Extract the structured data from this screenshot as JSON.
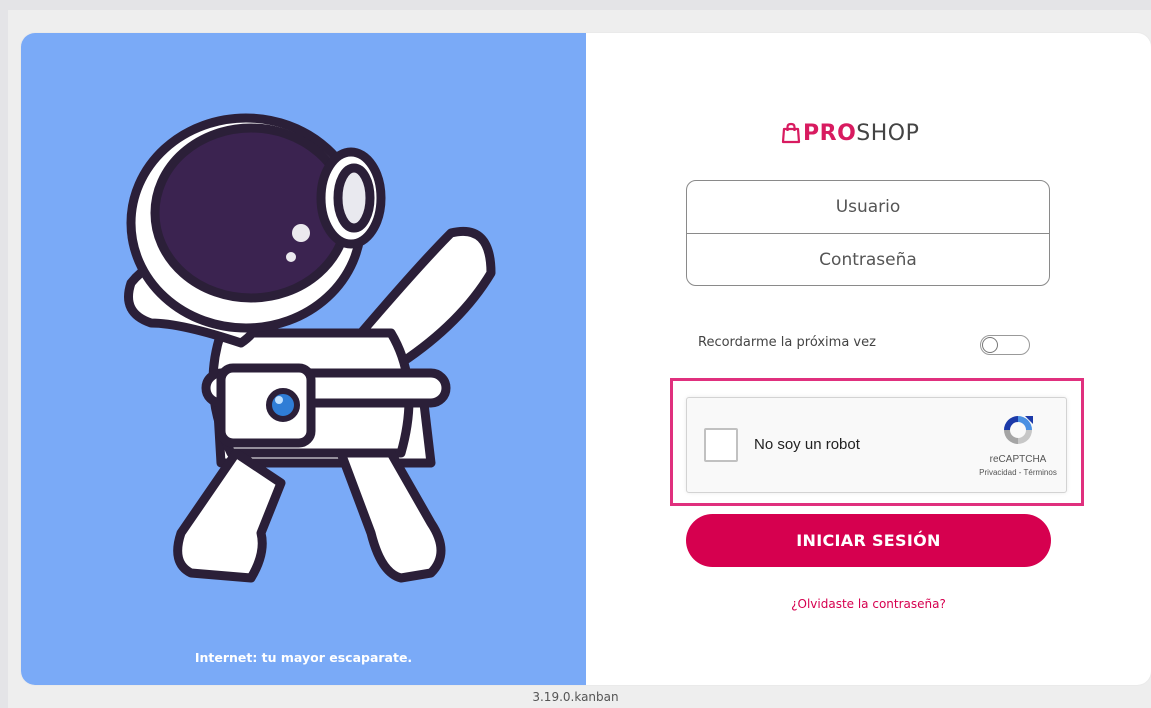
{
  "hero": {
    "tagline": "Internet: tu mayor escaparate.",
    "illustration": "astronaut-dabbing-illustration"
  },
  "login": {
    "logo_pro": "PRO",
    "logo_shop": "SHOP",
    "username_placeholder": "Usuario",
    "password_placeholder": "Contraseña",
    "remember_label": "Recordarme la próxima vez",
    "remember_on": false,
    "captcha_label": "No soy un robot",
    "captcha_brand": "reCAPTCHA",
    "captcha_terms": "Privacidad - Términos",
    "submit_label": "INICIAR SESIÓN",
    "forgot_label": "¿Olvidaste la contraseña?"
  },
  "footer": {
    "version": "3.19.0.kanban"
  },
  "colors": {
    "accent": "#d6004f",
    "hero_background": "#7aaaf7",
    "highlight_border": "#e0307e"
  },
  "icons": [
    "shopping-bag-icon",
    "recaptcha-icon",
    "checkbox-icon",
    "toggle-icon"
  ]
}
